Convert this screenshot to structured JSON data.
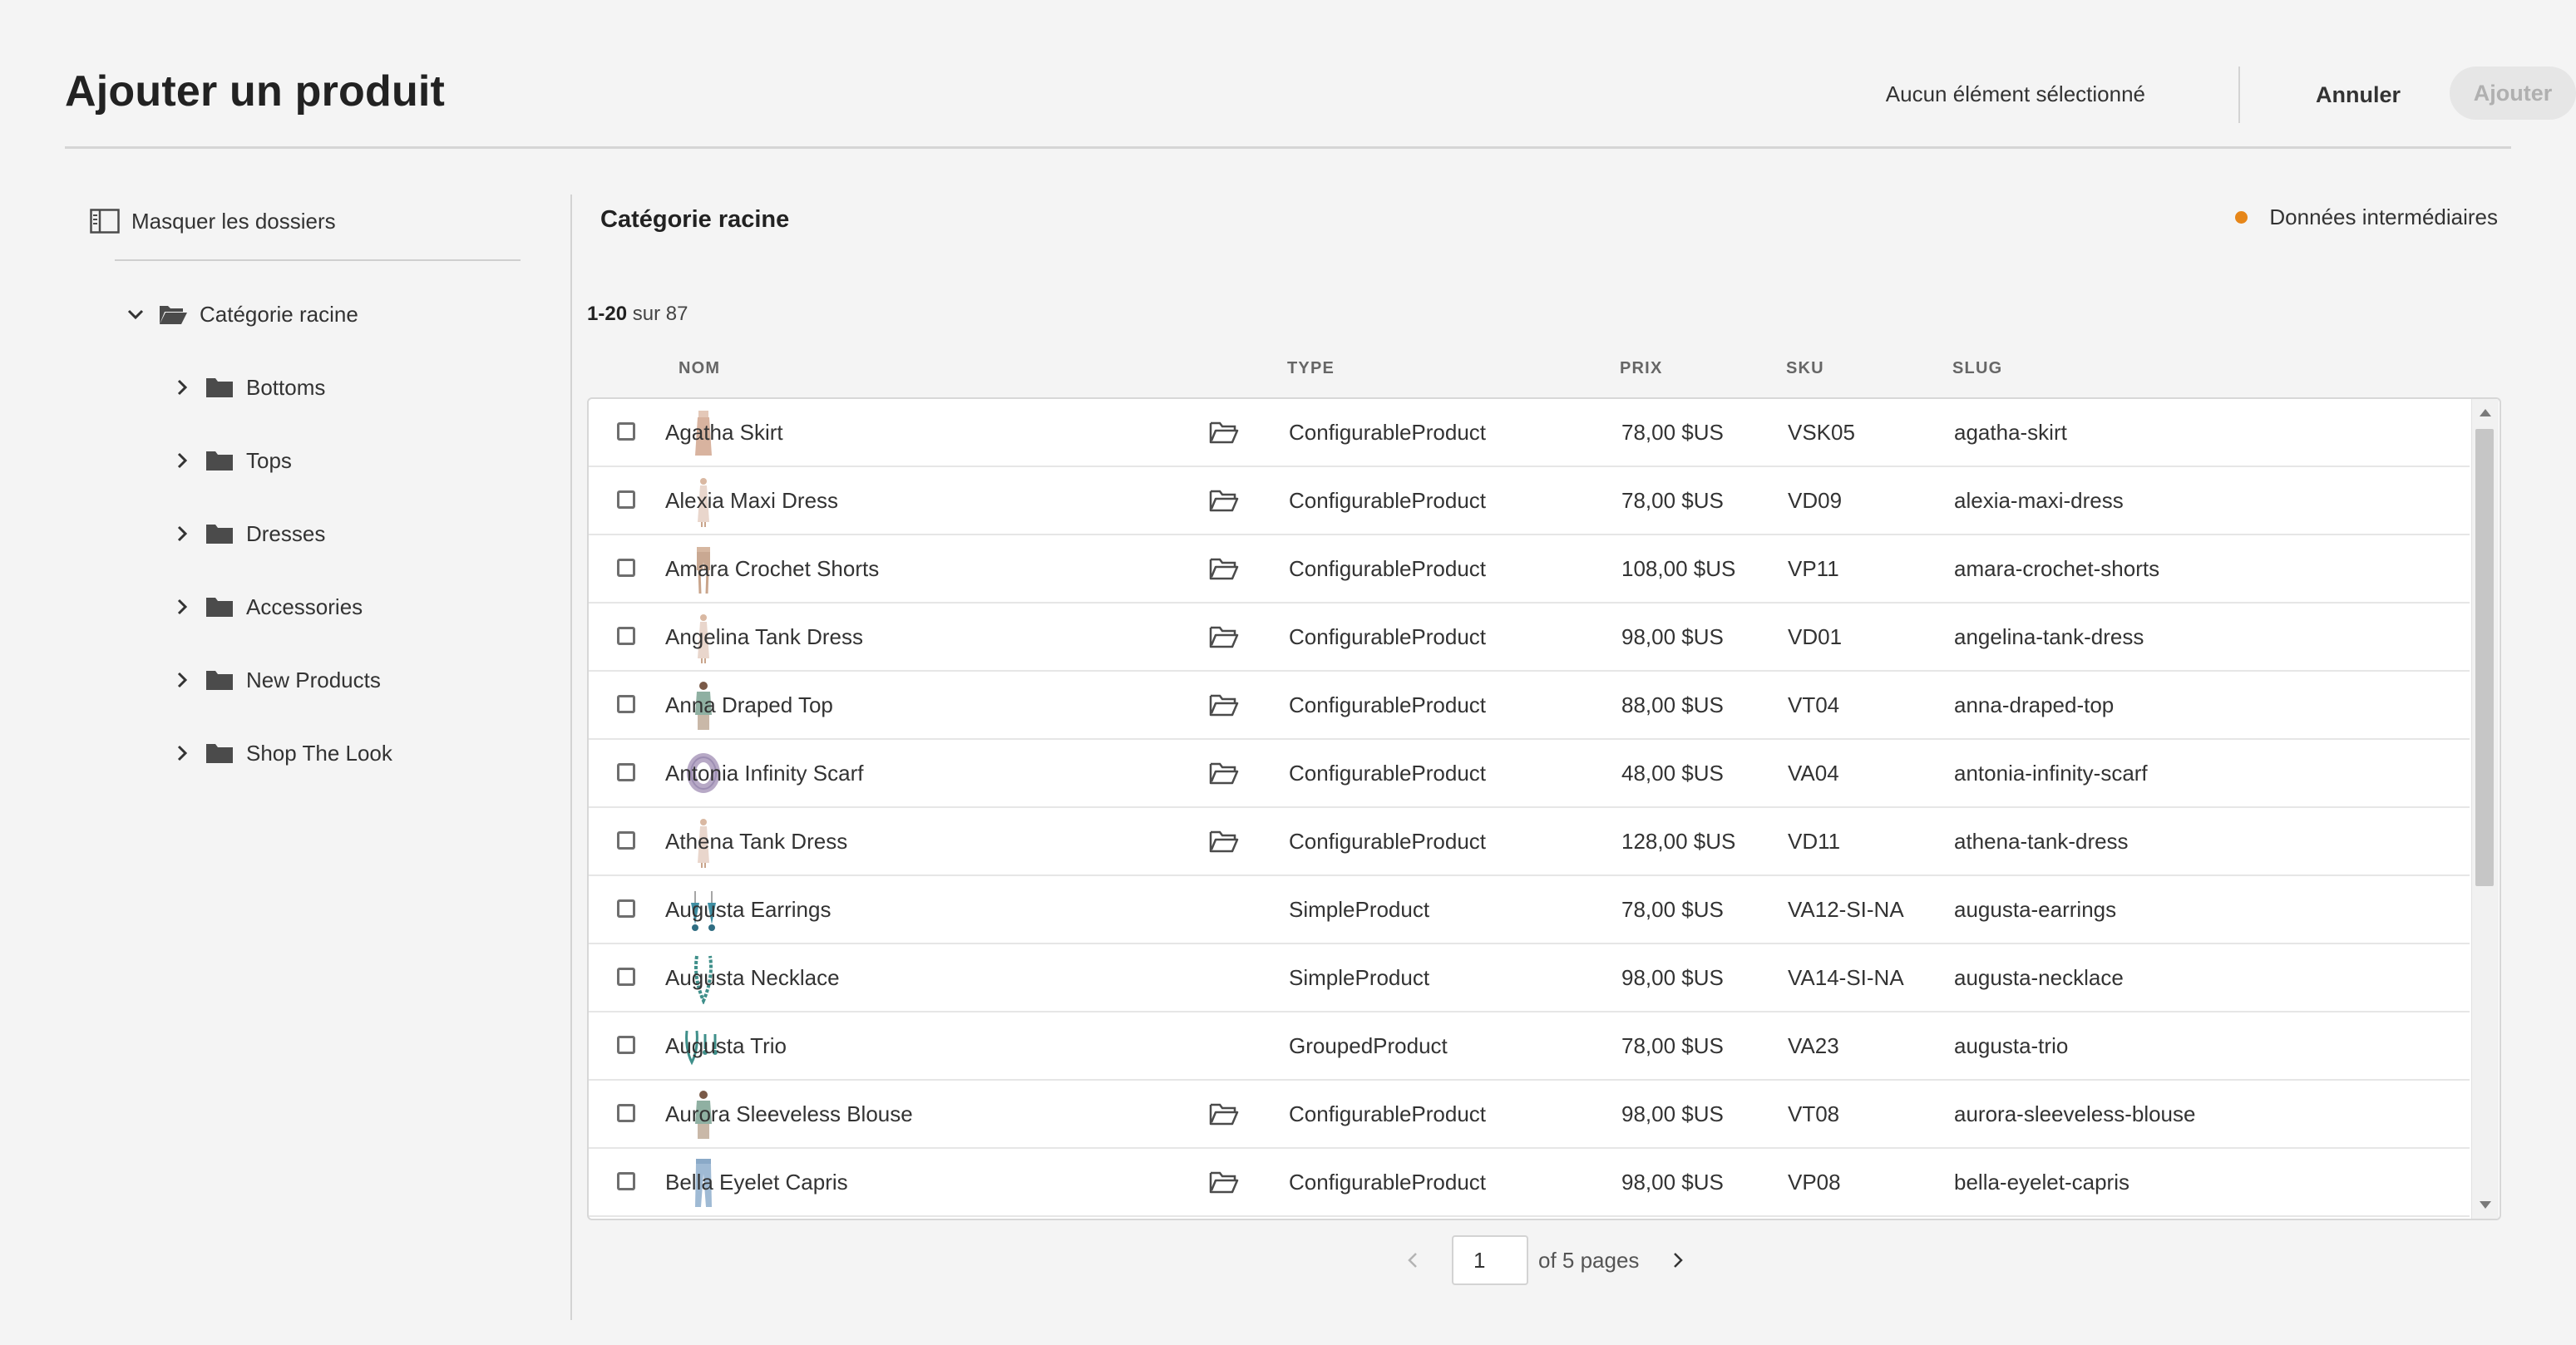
{
  "header": {
    "title": "Ajouter un produit",
    "selection_status": "Aucun élément sélectionné",
    "cancel_label": "Annuler",
    "add_label": "Ajouter"
  },
  "sidebar": {
    "hide_folders_label": "Masquer les dossiers",
    "root_label": "Catégorie racine",
    "items": [
      {
        "label": "Bottoms"
      },
      {
        "label": "Tops"
      },
      {
        "label": "Dresses"
      },
      {
        "label": "Accessories"
      },
      {
        "label": "New Products"
      },
      {
        "label": "Shop The Look"
      }
    ]
  },
  "main": {
    "title": "Catégorie racine",
    "legend_label": "Données intermédiaires",
    "legend_color": "#e68619",
    "count_range": "1-20",
    "count_rest": " sur 87",
    "columns": {
      "name": "NOM",
      "type": "TYPE",
      "price": "PRIX",
      "sku": "SKU",
      "slug": "SLUG"
    },
    "rows": [
      {
        "name": "Agatha Skirt",
        "type": "ConfigurableProduct",
        "price": "78,00 $US",
        "sku": "VSK05",
        "slug": "agatha-skirt",
        "has_folder": true,
        "thumb": "skirt"
      },
      {
        "name": "Alexia Maxi Dress",
        "type": "ConfigurableProduct",
        "price": "78,00 $US",
        "sku": "VD09",
        "slug": "alexia-maxi-dress",
        "has_folder": true,
        "thumb": "dress"
      },
      {
        "name": "Amara Crochet Shorts",
        "type": "ConfigurableProduct",
        "price": "108,00 $US",
        "sku": "VP11",
        "slug": "amara-crochet-shorts",
        "has_folder": true,
        "thumb": "shorts"
      },
      {
        "name": "Angelina Tank Dress",
        "type": "ConfigurableProduct",
        "price": "98,00 $US",
        "sku": "VD01",
        "slug": "angelina-tank-dress",
        "has_folder": true,
        "thumb": "dress"
      },
      {
        "name": "Anna Draped Top",
        "type": "ConfigurableProduct",
        "price": "88,00 $US",
        "sku": "VT04",
        "slug": "anna-draped-top",
        "has_folder": true,
        "thumb": "top"
      },
      {
        "name": "Antonia Infinity Scarf",
        "type": "ConfigurableProduct",
        "price": "48,00 $US",
        "sku": "VA04",
        "slug": "antonia-infinity-scarf",
        "has_folder": true,
        "thumb": "scarf"
      },
      {
        "name": "Athena Tank Dress",
        "type": "ConfigurableProduct",
        "price": "128,00 $US",
        "sku": "VD11",
        "slug": "athena-tank-dress",
        "has_folder": true,
        "thumb": "dress"
      },
      {
        "name": "Augusta Earrings",
        "type": "SimpleProduct",
        "price": "78,00 $US",
        "sku": "VA12-SI-NA",
        "slug": "augusta-earrings",
        "has_folder": false,
        "thumb": "earrings"
      },
      {
        "name": "Augusta Necklace",
        "type": "SimpleProduct",
        "price": "98,00 $US",
        "sku": "VA14-SI-NA",
        "slug": "augusta-necklace",
        "has_folder": false,
        "thumb": "necklace"
      },
      {
        "name": "Augusta Trio",
        "type": "GroupedProduct",
        "price": "78,00 $US",
        "sku": "VA23",
        "slug": "augusta-trio",
        "has_folder": false,
        "thumb": "trio"
      },
      {
        "name": "Aurora Sleeveless Blouse",
        "type": "ConfigurableProduct",
        "price": "98,00 $US",
        "sku": "VT08",
        "slug": "aurora-sleeveless-blouse",
        "has_folder": true,
        "thumb": "top"
      },
      {
        "name": "Bella Eyelet Capris",
        "type": "ConfigurableProduct",
        "price": "98,00 $US",
        "sku": "VP08",
        "slug": "bella-eyelet-capris",
        "has_folder": true,
        "thumb": "pants"
      }
    ]
  },
  "pagination": {
    "current_page": "1",
    "of_pages": "of 5 pages"
  }
}
